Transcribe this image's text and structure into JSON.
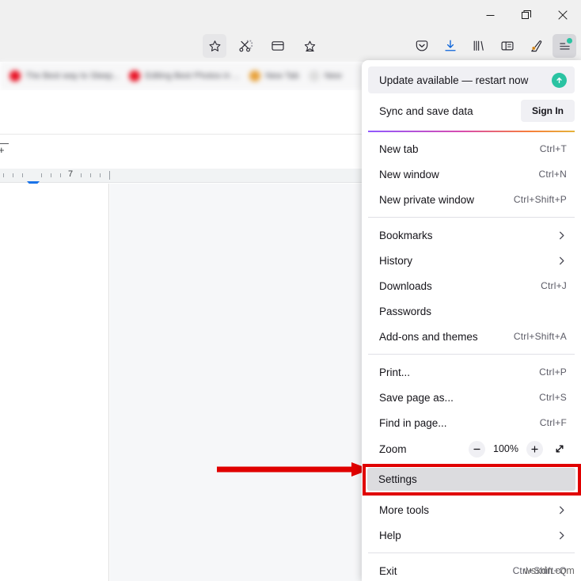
{
  "window": {
    "controls": [
      {
        "name": "minimize",
        "glyph": "minimize-icon"
      },
      {
        "name": "maximize",
        "glyph": "restore-icon"
      },
      {
        "name": "close",
        "glyph": "close-icon"
      }
    ]
  },
  "toolbar": {
    "left_icons": [
      {
        "name": "bookmark-star-icon",
        "label": "Bookmark this page"
      },
      {
        "name": "screenshot-scissors-icon",
        "label": "Take a screenshot"
      },
      {
        "name": "reader-card-icon",
        "label": "Reader view"
      },
      {
        "name": "save-to-pocket-star-icon",
        "label": "Save page"
      }
    ],
    "right_icons": [
      {
        "name": "pocket-icon",
        "label": "Save to Pocket"
      },
      {
        "name": "downloads-icon",
        "label": "Downloads"
      },
      {
        "name": "library-icon",
        "label": "Library"
      },
      {
        "name": "sidebar-icon",
        "label": "Sidebars"
      },
      {
        "name": "extension-icon",
        "label": "Extension"
      },
      {
        "name": "app-menu-icon",
        "label": "Open application menu"
      }
    ]
  },
  "tabs": [
    {
      "title": "The Best way to Sleep...",
      "favicon_color": "#e81123"
    },
    {
      "title": "Editing Best Photos in ...",
      "favicon_color": "#e81123"
    },
    {
      "title": "New Tab",
      "favicon_color": "#e8a13a"
    },
    {
      "title": "New",
      "favicon_color": "#dddddd"
    }
  ],
  "document": {
    "ruler_label": "7"
  },
  "menu": {
    "update": {
      "label": "Update available — restart now",
      "icon": "update-arrow-up-icon",
      "icon_color": "#2ac3a2"
    },
    "sync": {
      "label": "Sync and save data",
      "button_label": "Sign In"
    },
    "groups": [
      {
        "items": [
          {
            "label": "New tab",
            "accel": "Ctrl+T",
            "name": "new-tab"
          },
          {
            "label": "New window",
            "accel": "Ctrl+N",
            "name": "new-window"
          },
          {
            "label": "New private window",
            "accel": "Ctrl+Shift+P",
            "name": "new-private-window"
          }
        ]
      },
      {
        "items": [
          {
            "label": "Bookmarks",
            "accel": "",
            "submenu": true,
            "name": "bookmarks"
          },
          {
            "label": "History",
            "accel": "",
            "submenu": true,
            "name": "history"
          },
          {
            "label": "Downloads",
            "accel": "Ctrl+J",
            "name": "downloads"
          },
          {
            "label": "Passwords",
            "accel": "",
            "name": "passwords"
          },
          {
            "label": "Add-ons and themes",
            "accel": "Ctrl+Shift+A",
            "name": "addons-and-themes"
          }
        ]
      },
      {
        "items": [
          {
            "label": "Print...",
            "accel": "Ctrl+P",
            "name": "print"
          },
          {
            "label": "Save page as...",
            "accel": "Ctrl+S",
            "name": "save-page-as"
          },
          {
            "label": "Find in page...",
            "accel": "Ctrl+F",
            "name": "find-in-page"
          }
        ]
      }
    ],
    "zoom": {
      "label": "Zoom",
      "value": "100%",
      "minus": "−",
      "plus": "+",
      "fullscreen_icon": "expand-diagonal-icon"
    },
    "settings": {
      "label": "Settings",
      "highlighted": true,
      "highlight_color": "#e00000"
    },
    "tail_items": [
      {
        "label": "More tools",
        "accel": "",
        "submenu": true,
        "name": "more-tools"
      },
      {
        "label": "Help",
        "accel": "",
        "submenu": true,
        "name": "help"
      }
    ],
    "exit": {
      "label": "Exit",
      "accel": "Ctrl+Shift+Q"
    }
  },
  "annotation": {
    "arrow_color": "#e00000",
    "points_to": "Settings"
  },
  "watermark": {
    "text": "wsxdn.com"
  }
}
